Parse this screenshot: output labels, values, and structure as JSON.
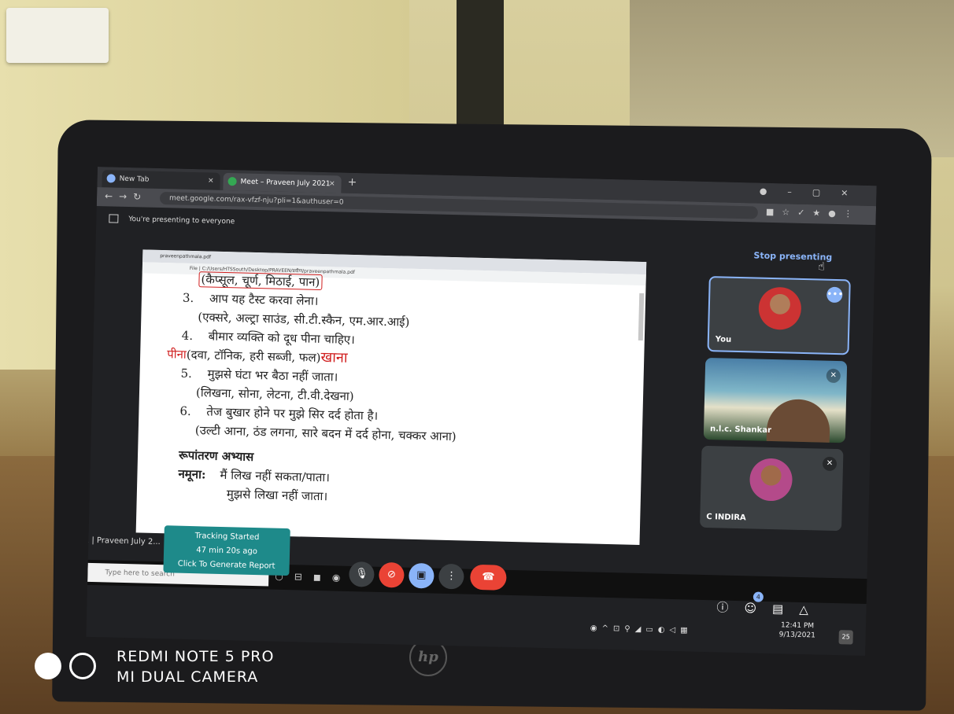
{
  "browser": {
    "tabs": [
      {
        "label": "New Tab"
      },
      {
        "label": "Meet – Praveen July 2021"
      }
    ],
    "url": "meet.google.com/rax-vfzf-nju?pli=1&authuser=0"
  },
  "meet": {
    "presenting_notice": "You're presenting to everyone",
    "stop_presenting": "Stop presenting",
    "participants": [
      {
        "name": "You"
      },
      {
        "name": "n.l.c. Shankar"
      },
      {
        "name": "C INDIRA"
      }
    ],
    "people_count": "4",
    "meeting_label": "12:41  |  Praveen July 2..."
  },
  "pdf": {
    "tab_title": "praveenpathmala.pdf",
    "address": "File  |  C:/Users/HTSSouth/Desktop/PRAVEEN/प्रवीण/praveenpathmala.pdf",
    "lines": {
      "l0": "(कैप्सूल, चूर्ण, मिठाई, पान)",
      "l1_num": "3.",
      "l1": "आप यह टैस्ट करवा लेना।",
      "l2": "(एक्सरे, अल्ट्रा साउंड, सी.टी.स्कैन, एम.आर.आई)",
      "l3_num": "4.",
      "l3": "बीमार व्यक्ति को दूध पीना चाहिए।",
      "l4_red1": "पीना",
      "l4": "(दवा, टॉनिक, हरी सब्जी, फल)",
      "l4_red2": "खाना",
      "l5_num": "5.",
      "l5": "मुझसे घंटा भर बैठा नहीं जाता।",
      "l6": "(लिखना, सोना, लेटना, टी.वी.देखना)",
      "l7_num": "6.",
      "l7": "तेज बुखार होने पर मुझे सिर दर्द होता है।",
      "l8": "(उल्टी आना, ठंड लगना, सारे बदन में दर्द होना, चक्कर आना)",
      "l9": "रूपांतरण अभ्यास",
      "l10_label": "नमूना:",
      "l10": "मैं लिख नहीं सकता/पाता।",
      "l11": "मुझसे लिखा नहीं जाता।"
    }
  },
  "tracking": {
    "line1": "Tracking Started",
    "line2": "47 min 20s ago",
    "line3": "Click To Generate Report"
  },
  "taskbar": {
    "search_placeholder": "Type here to search",
    "time": "12:41 PM",
    "date": "9/13/2021",
    "notifications": "25"
  },
  "watermark": {
    "line1": "REDMI NOTE 5 PRO",
    "line2": "MI DUAL CAMERA"
  },
  "icons": [
    "mic-icon",
    "camera-off-icon",
    "present-icon",
    "more-icon",
    "end-call-icon",
    "info-icon",
    "people-icon",
    "chat-icon",
    "activities-icon"
  ],
  "colors": {
    "meet_blue": "#8ab4f8",
    "end_call_red": "#ea4335",
    "annotation_red": "#d01d1d"
  }
}
